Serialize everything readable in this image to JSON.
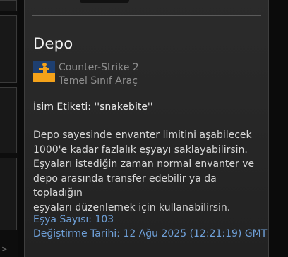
{
  "item": {
    "name": "Depo",
    "game": "Counter-Strike 2",
    "type": "Temel Sınıf Araç",
    "name_tag": "İsim Etiketi: ''snakebite''",
    "description_lines": [
      "Depo sayesinde envanter limitini aşabilecek",
      "1000'e kadar fazlalık eşyayı saklayabilirsin.",
      "Eşyaları istediğin zaman normal envanter ve",
      "depo arasında transfer edebilir ya da topladığın",
      "eşyaları düzenlemek için kullanabilirsin."
    ],
    "item_count": "Eşya Sayısı: 103",
    "modified_date": "Değiştirme Tarihi: 12 Ağu 2025 (12:21:19) GMT"
  },
  "colors": {
    "panel_bg": "#262626",
    "link_blue": "#6fa0d8",
    "game_icon_blue": "#1e3f70",
    "game_icon_orange": "#f4a21a"
  },
  "icons": {
    "game_icon": "cs2-game-icon",
    "left_arrow": "chevron-right-icon"
  },
  "nav": {
    "left_arrow_glyph": ">"
  }
}
